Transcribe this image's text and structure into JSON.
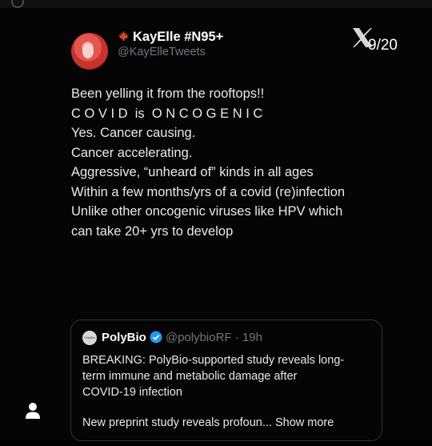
{
  "viewer": {
    "counter": "9/20"
  },
  "tweet": {
    "display_name": "KayElle #N95+",
    "handle": "@KayElleTweets",
    "lines": [
      "Been yelling it from the rooftops!!",
      "",
      "C O V I D  is  O N C O G E N I C",
      "Yes. Cancer causing.",
      "Cancer accelerating.",
      "Aggressive, “unheard of” kinds in all ages",
      "",
      "Within a few months/yrs of a covid (re)infection",
      "",
      "Unlike other oncogenic viruses like HPV which",
      "can take 20+ yrs to develop"
    ]
  },
  "quote": {
    "avatar_text": "PolyBio",
    "name": "PolyBio",
    "handle_time": "@polybioRF · 19h",
    "text_lines": [
      "BREAKING: PolyBio-supported study reveals long-",
      "term immune and metabolic damage after",
      "COVID-19 infection"
    ],
    "preview": "New preprint study reveals profoun... Show more"
  },
  "icons": {
    "leaf": "maple-leaf-icon",
    "x": "x-logo-icon",
    "verified": "verified-badge-icon",
    "person": "person-icon"
  },
  "colors": {
    "background": "#000000",
    "text": "#e7e9ea",
    "muted": "#71767b",
    "verified": "#1d9bf0",
    "leaf": "#d9461e"
  }
}
